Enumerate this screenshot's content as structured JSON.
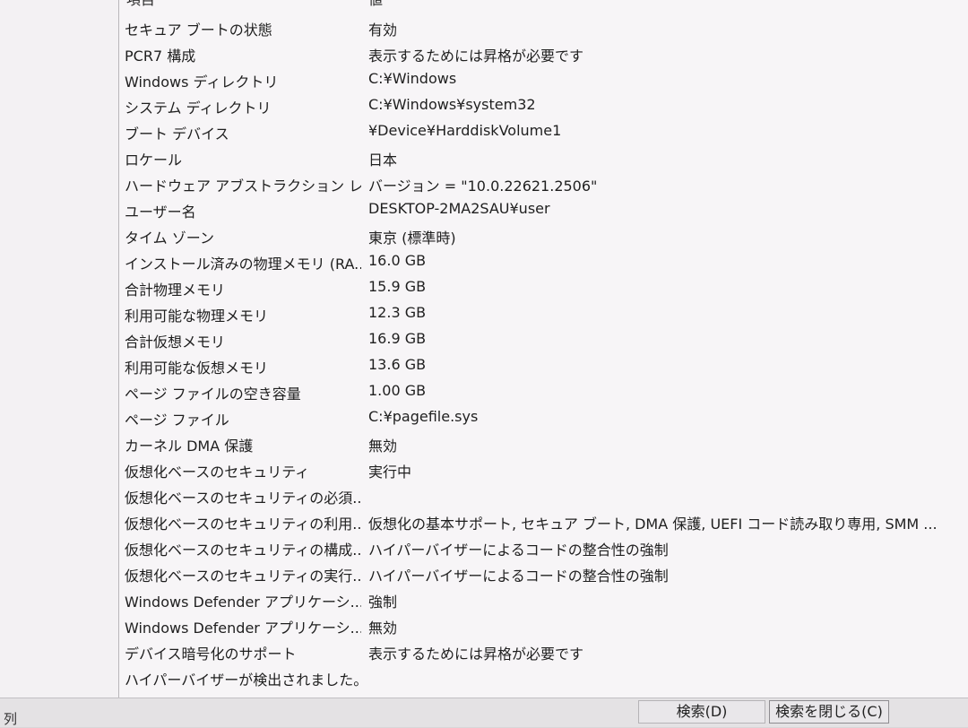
{
  "header": {
    "item": "項目",
    "value": "値"
  },
  "rows": [
    {
      "item": "セキュア ブートの状態",
      "value": "有効"
    },
    {
      "item": "PCR7 構成",
      "value": "表示するためには昇格が必要です"
    },
    {
      "item": "Windows ディレクトリ",
      "value": "C:¥Windows"
    },
    {
      "item": "システム ディレクトリ",
      "value": "C:¥Windows¥system32"
    },
    {
      "item": "ブート デバイス",
      "value": "¥Device¥HarddiskVolume1"
    },
    {
      "item": "ロケール",
      "value": "日本"
    },
    {
      "item": "ハードウェア アブストラクション レイ...",
      "value": "バージョン = \"10.0.22621.2506\""
    },
    {
      "item": "ユーザー名",
      "value": "DESKTOP-2MA2SAU¥user"
    },
    {
      "item": "タイム ゾーン",
      "value": "東京 (標準時)"
    },
    {
      "item": "インストール済みの物理メモリ (RA...",
      "value": "16.0 GB"
    },
    {
      "item": "合計物理メモリ",
      "value": "15.9 GB"
    },
    {
      "item": "利用可能な物理メモリ",
      "value": "12.3 GB"
    },
    {
      "item": "合計仮想メモリ",
      "value": "16.9 GB"
    },
    {
      "item": "利用可能な仮想メモリ",
      "value": "13.6 GB"
    },
    {
      "item": "ページ ファイルの空き容量",
      "value": "1.00 GB"
    },
    {
      "item": "ページ ファイル",
      "value": "C:¥pagefile.sys"
    },
    {
      "item": "カーネル DMA 保護",
      "value": "無効"
    },
    {
      "item": "仮想化ベースのセキュリティ",
      "value": "実行中"
    },
    {
      "item": "仮想化ベースのセキュリティの必須...",
      "value": ""
    },
    {
      "item": "仮想化ベースのセキュリティの利用...",
      "value": "仮想化の基本サポート, セキュア ブート, DMA 保護, UEFI コード読み取り専用, SMM ..."
    },
    {
      "item": "仮想化ベースのセキュリティの構成...",
      "value": "ハイパーバイザーによるコードの整合性の強制"
    },
    {
      "item": "仮想化ベースのセキュリティの実行...",
      "value": "ハイパーバイザーによるコードの整合性の強制"
    },
    {
      "item": "Windows Defender アプリケーシ...",
      "value": "強制"
    },
    {
      "item": "Windows Defender アプリケーシ...",
      "value": "無効"
    },
    {
      "item": "デバイス暗号化のサポート",
      "value": "表示するためには昇格が必要です"
    },
    {
      "item": "ハイパーバイザーが検出されました。...",
      "value": ""
    }
  ],
  "footer": {
    "status_text": "列",
    "search_button": "検索(D)",
    "close_search_button": "検索を閉じる(C)"
  }
}
